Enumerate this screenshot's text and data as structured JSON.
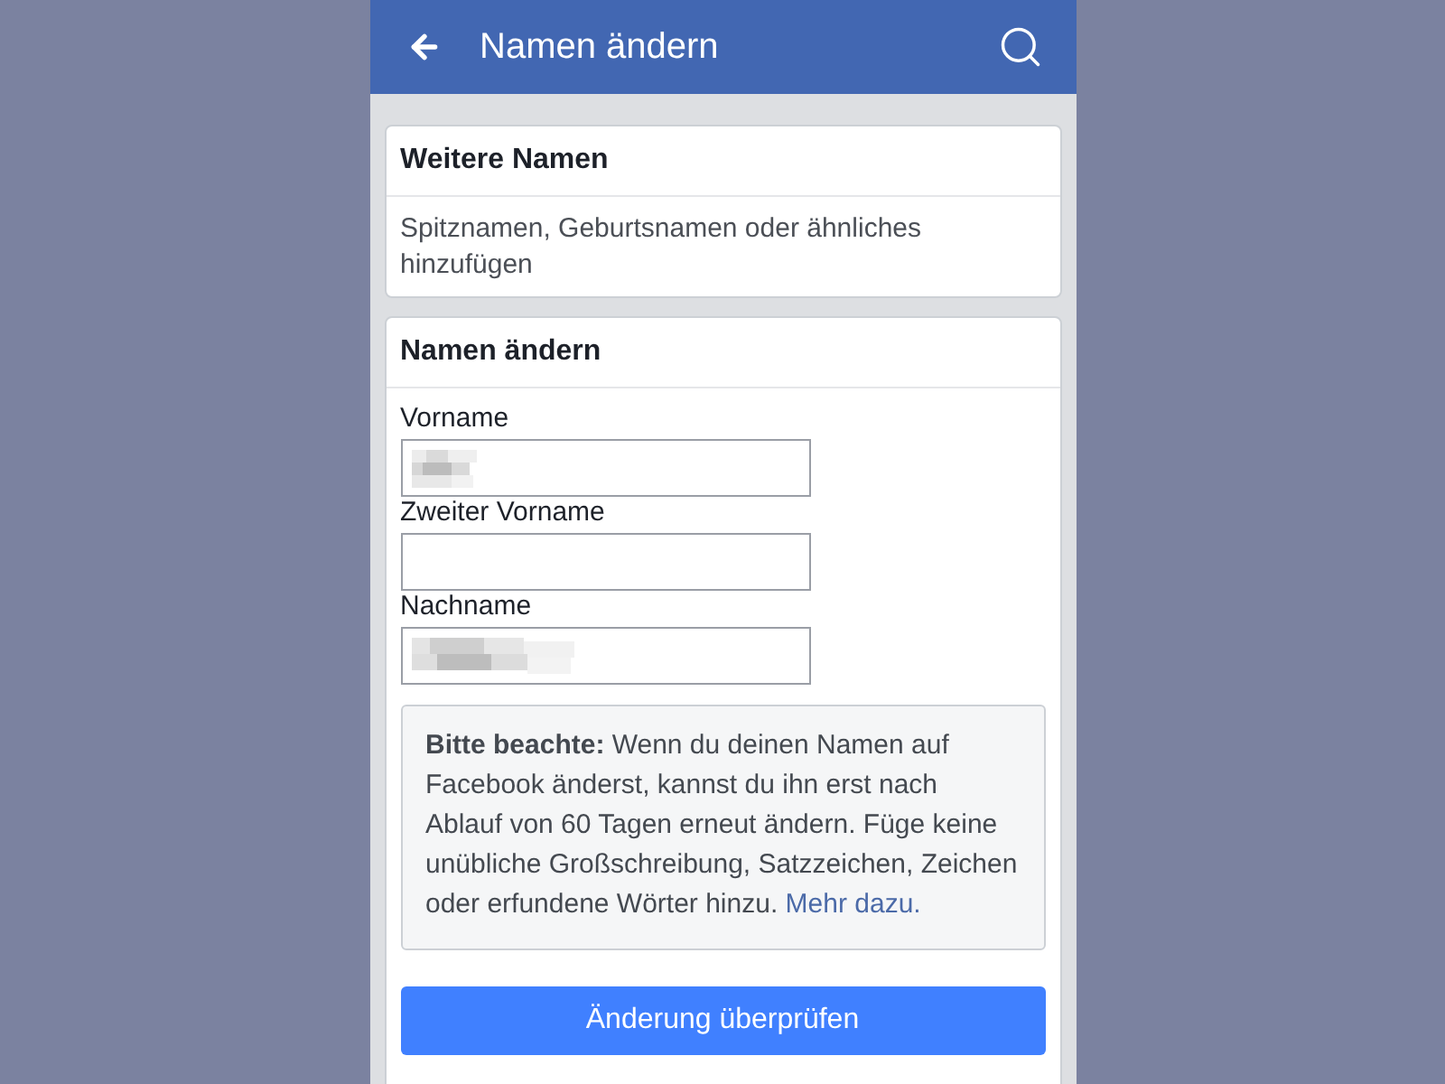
{
  "header": {
    "title": "Namen ändern"
  },
  "other_names": {
    "title": "Weitere Namen",
    "description": "Spitznamen, Geburtsnamen oder ähnliches hinzufügen"
  },
  "change_name": {
    "title": "Namen ändern",
    "fields": [
      {
        "label": "Vorname",
        "redacted": true
      },
      {
        "label": "Zweiter Vorname",
        "redacted": false
      },
      {
        "label": "Nachname",
        "redacted": true
      }
    ],
    "notice": {
      "text": "**Bitte beachte:** Wenn du deinen Namen auf Facebook änderst, kannst du ihn erst nach Ablauf von 60 Tagen erneut ändern. Füge keine unübliche Großschreibung, Satzzeichen, Zeichen oder erfundene Wörter hinzu.",
      "link": "Mehr dazu."
    },
    "submit_button": "Änderung überprüfen"
  }
}
